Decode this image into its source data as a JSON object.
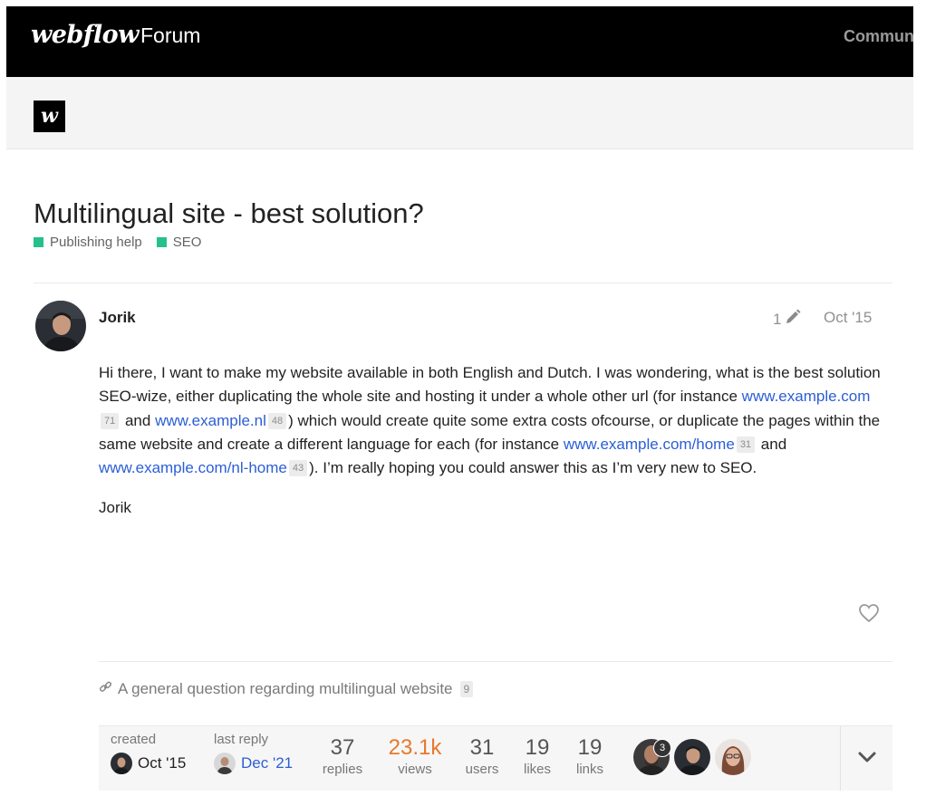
{
  "header": {
    "brand": "webflow",
    "section": "Forum",
    "right_link": "Communi"
  },
  "subheader": {
    "logo_letter": "w"
  },
  "topic": {
    "title": "Multilingual site - best solution?",
    "categories": [
      {
        "label": "Publishing help",
        "color": "#25c08c"
      },
      {
        "label": "SEO",
        "color": "#25c08c"
      }
    ]
  },
  "post": {
    "author": "Jorik",
    "edit_count": "1",
    "date": "Oct '15",
    "text_1": "Hi there, I want to make my website available in both English and Dutch. I was wondering, what is the best solution SEO-wize, either duplicating the whole site and hosting it under a whole other url (for instance ",
    "link_1": "www.example.com",
    "link_1_count": "71",
    "text_2": " and ",
    "link_2": "www.example.nl",
    "link_2_count": "48",
    "text_3": ") which would create quite some extra costs ofcourse, or duplicate the pages within the same website and create a different language for each (for instance ",
    "link_3": "www.example.com/home",
    "link_3_count": "31",
    "text_4": " and ",
    "link_4": "www.example.com/nl-home",
    "link_4_count": "43",
    "text_5": "). I’m really hoping you could answer this as I’m very new to SEO.",
    "signature": "Jorik"
  },
  "related": {
    "label": "A general question regarding multilingual website",
    "count": "9"
  },
  "footer": {
    "created_label": "created",
    "created_date": "Oct '15",
    "last_reply_label": "last reply",
    "last_reply_date": "Dec '21",
    "stats": [
      {
        "num": "37",
        "label": "replies",
        "color": "#555555"
      },
      {
        "num": "23.1k",
        "label": "views",
        "color": "#e8782b"
      },
      {
        "num": "31",
        "label": "users",
        "color": "#555555"
      },
      {
        "num": "19",
        "label": "likes",
        "color": "#555555"
      },
      {
        "num": "19",
        "label": "links",
        "color": "#555555"
      }
    ],
    "avatar_badge": "3"
  },
  "colors": {
    "link": "#2b5ed6",
    "category": "#25c08c",
    "views": "#e8782b"
  },
  "icons": [
    "pencil-icon",
    "heart-icon",
    "link-icon",
    "chevron-down-icon"
  ]
}
